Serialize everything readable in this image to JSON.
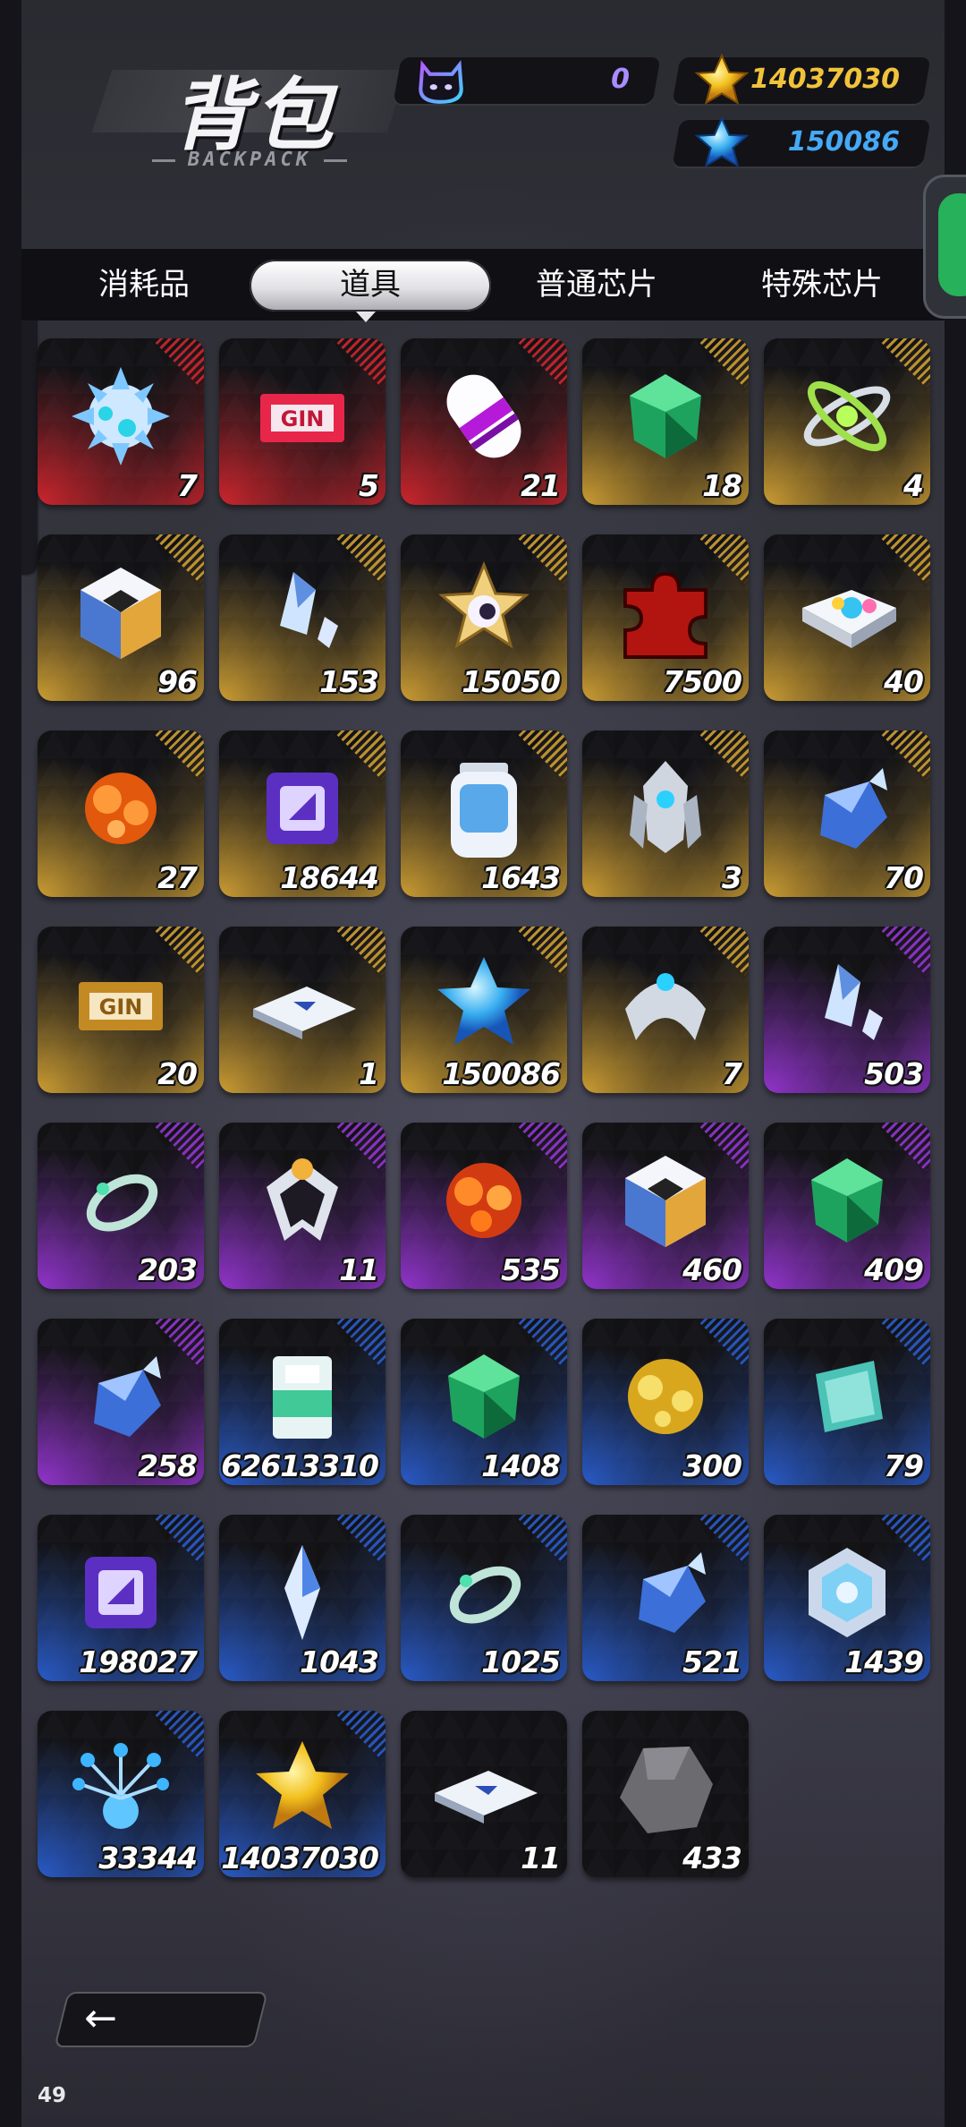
{
  "header": {
    "title": "背包",
    "subtitle": "BACKPACK"
  },
  "currencies": [
    {
      "id": "cat",
      "icon": "cat-token-icon",
      "value": "0",
      "color": "#a98cff"
    },
    {
      "id": "gold",
      "icon": "gold-star-icon",
      "value": "14037030",
      "color": "#f1c33a"
    },
    {
      "id": "blue",
      "icon": "blue-star-icon",
      "value": "150086",
      "color": "#45a9f5"
    }
  ],
  "tabs": [
    {
      "label": "消耗品",
      "active": false
    },
    {
      "label": "道具",
      "active": true
    },
    {
      "label": "普通芯片",
      "active": false
    },
    {
      "label": "特殊芯片",
      "active": false
    }
  ],
  "items": [
    {
      "icon": "spiked-orb-icon",
      "qty": "7",
      "rarity": "red"
    },
    {
      "icon": "film-ticket-icon",
      "qty": "5",
      "rarity": "red"
    },
    {
      "icon": "capsule-icon",
      "qty": "21",
      "rarity": "red"
    },
    {
      "icon": "green-gem-icon",
      "qty": "18",
      "rarity": "gold"
    },
    {
      "icon": "atom-ring-icon",
      "qty": "4",
      "rarity": "gold"
    },
    {
      "icon": "prism-cube-icon",
      "qty": "96",
      "rarity": "gold"
    },
    {
      "icon": "crystal-shards-icon",
      "qty": "153",
      "rarity": "gold"
    },
    {
      "icon": "star-eye-icon",
      "qty": "15050",
      "rarity": "gold"
    },
    {
      "icon": "puzzle-piece-icon",
      "qty": "7500",
      "rarity": "gold"
    },
    {
      "icon": "paint-book-icon",
      "qty": "40",
      "rarity": "gold"
    },
    {
      "icon": "spiked-orange-orb-icon",
      "qty": "27",
      "rarity": "gold"
    },
    {
      "icon": "chip-icon",
      "qty": "18644",
      "rarity": "gold"
    },
    {
      "icon": "battery-bottle-icon",
      "qty": "1643",
      "rarity": "gold"
    },
    {
      "icon": "mech-claw-icon",
      "qty": "3",
      "rarity": "gold"
    },
    {
      "icon": "blue-crystal-cluster-icon",
      "qty": "70",
      "rarity": "gold"
    },
    {
      "icon": "gold-film-ticket-icon",
      "qty": "20",
      "rarity": "gold"
    },
    {
      "icon": "blueprint-plate-icon",
      "qty": "1",
      "rarity": "gold"
    },
    {
      "icon": "blue-star-icon",
      "qty": "150086",
      "rarity": "gold"
    },
    {
      "icon": "mech-arc-icon",
      "qty": "7",
      "rarity": "gold"
    },
    {
      "icon": "crystal-shards-icon",
      "qty": "503",
      "rarity": "purple"
    },
    {
      "icon": "ring-icon",
      "qty": "203",
      "rarity": "purple"
    },
    {
      "icon": "badge-icon",
      "qty": "11",
      "rarity": "purple"
    },
    {
      "icon": "orange-orb-cluster-icon",
      "qty": "535",
      "rarity": "purple"
    },
    {
      "icon": "prism-cube-icon",
      "qty": "460",
      "rarity": "purple"
    },
    {
      "icon": "green-gem-icon",
      "qty": "409",
      "rarity": "purple"
    },
    {
      "icon": "blue-crystal-cluster-icon",
      "qty": "258",
      "rarity": "purple"
    },
    {
      "icon": "glass-cube-icon",
      "qty": "62613310",
      "rarity": "blue"
    },
    {
      "icon": "green-gem-icon",
      "qty": "1408",
      "rarity": "blue"
    },
    {
      "icon": "spiked-gold-orb-icon",
      "qty": "300",
      "rarity": "blue"
    },
    {
      "icon": "data-card-icon",
      "qty": "79",
      "rarity": "blue"
    },
    {
      "icon": "chip-icon",
      "qty": "198027",
      "rarity": "blue"
    },
    {
      "icon": "crystal-shard-icon",
      "qty": "1043",
      "rarity": "blue"
    },
    {
      "icon": "ring-icon",
      "qty": "1025",
      "rarity": "blue"
    },
    {
      "icon": "blue-crystal-cluster-icon",
      "qty": "521",
      "rarity": "blue"
    },
    {
      "icon": "hex-crystal-icon",
      "qty": "1439",
      "rarity": "blue"
    },
    {
      "icon": "crystal-flower-icon",
      "qty": "33344",
      "rarity": "blue"
    },
    {
      "icon": "gold-star-icon",
      "qty": "14037030",
      "rarity": "blue"
    },
    {
      "icon": "blueprint-plate-icon",
      "qty": "11",
      "rarity": "none"
    },
    {
      "icon": "stone-icon",
      "qty": "433",
      "rarity": "none"
    }
  ],
  "rarity_colors": {
    "red": "#d8262e",
    "gold": "#d7a534",
    "purple": "#9a36d8",
    "blue": "#2a5fd3",
    "none": "#2a2a2f"
  },
  "back_button": {
    "icon": "arrow-left-icon",
    "label": "←"
  },
  "fps_counter": "49"
}
